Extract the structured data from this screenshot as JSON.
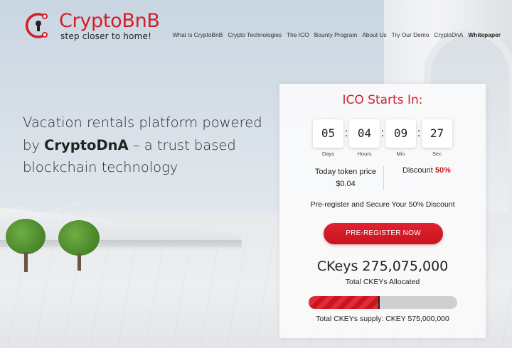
{
  "brand": {
    "name": "CryptoBnB",
    "tagline": "step closer to home!",
    "accent_color": "#d01f2c"
  },
  "nav": {
    "items": [
      {
        "label": "What is CryptoBnB"
      },
      {
        "label": "Crypto Technologies"
      },
      {
        "label": "The ICO"
      },
      {
        "label": "Bounty Program"
      },
      {
        "label": "About Us"
      },
      {
        "label": "Try Our Demo"
      },
      {
        "label": "CryptoDnA"
      },
      {
        "label": "Whitepaper"
      }
    ]
  },
  "hero": {
    "line_prefix": "Vacation rentals platform powered by ",
    "highlight": "CryptoDnA",
    "line_suffix": " – a trust based blockchain technology"
  },
  "ico": {
    "title": "ICO Starts In:",
    "countdown": [
      {
        "value": "05",
        "unit": "Days"
      },
      {
        "value": "04",
        "unit": "Hours"
      },
      {
        "value": "09",
        "unit": "Min"
      },
      {
        "value": "27",
        "unit": "Sec"
      }
    ],
    "separator": ":",
    "price_label": "Today token price",
    "price_value": "$0.04",
    "discount_label": "Discount",
    "discount_value": "50%",
    "secure_text": "Pre-register and Secure Your 50% Discount",
    "cta_label": "PRE-REGISTER NOW",
    "ckeys_amount": "CKeys 275,075,000",
    "allocated_label": "Total CKEYs Allocated",
    "allocated_fraction": 0.478,
    "supply_text": "Total CKEYs supply: CKEY 575,000,000"
  }
}
